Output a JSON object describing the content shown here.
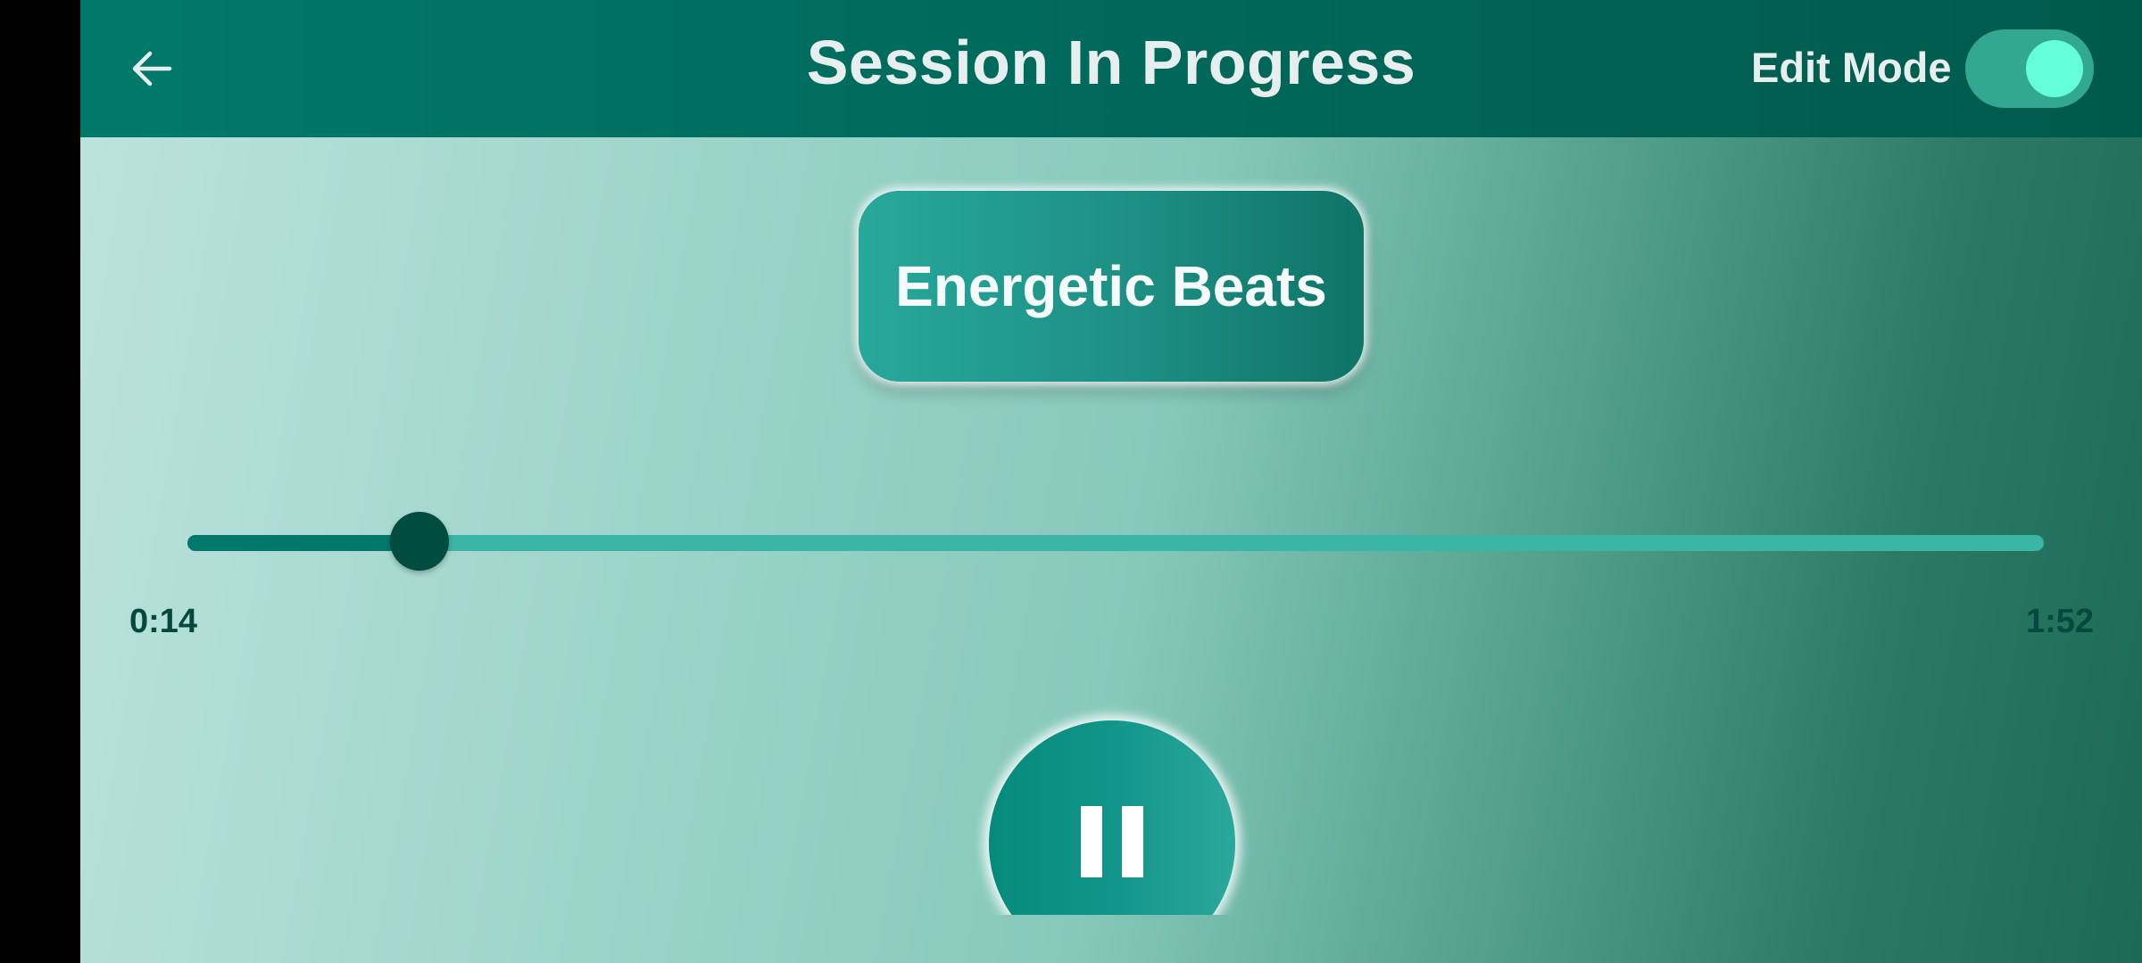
{
  "header": {
    "title": "Session In Progress",
    "back_icon": "arrow-left-icon",
    "edit_mode_label": "Edit Mode",
    "edit_mode_on": true
  },
  "track": {
    "name": "Energetic Beats"
  },
  "playback": {
    "elapsed": "0:14",
    "total": "1:52",
    "progress_fraction": 0.125,
    "state_icon": "pause-icon"
  },
  "colors": {
    "app_bar": "#00796b",
    "accent": "#64ffda",
    "slider_track": "#3ab5a6",
    "slider_fill": "#00796b",
    "slider_thumb": "#004d40",
    "time_text": "#05483d"
  }
}
